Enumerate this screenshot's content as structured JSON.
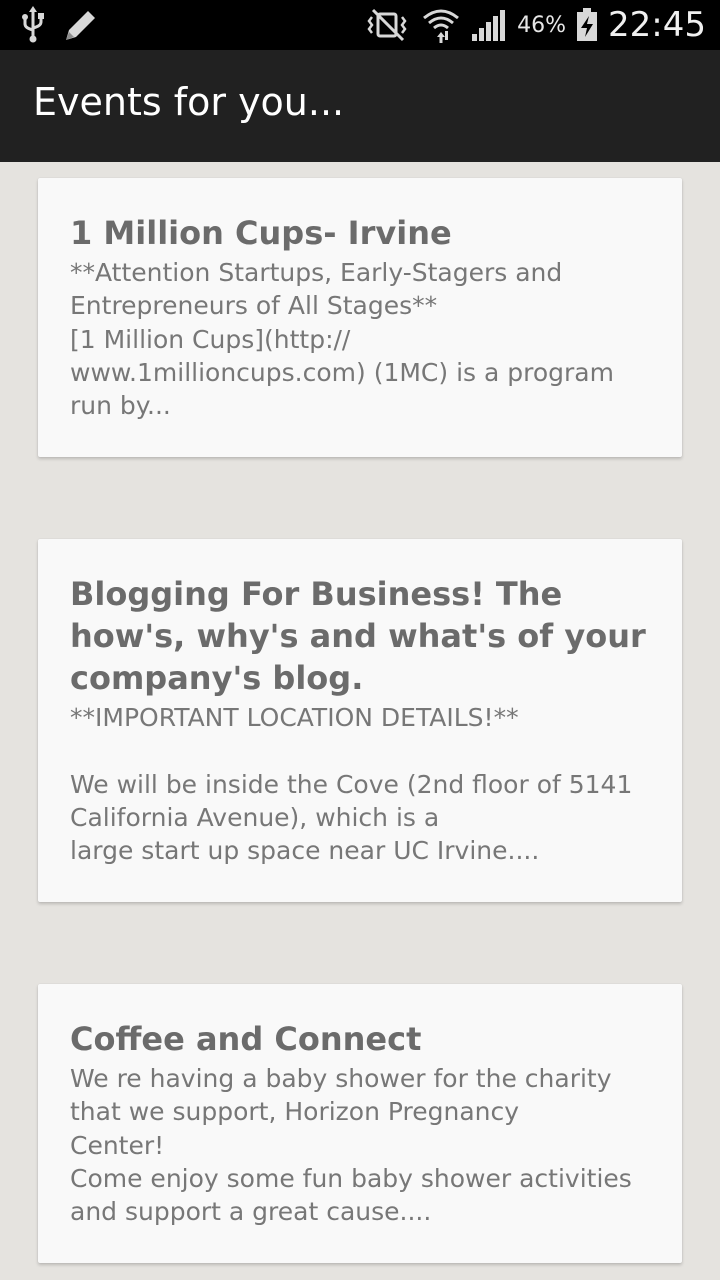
{
  "status_bar": {
    "battery_percent": "46%",
    "time": "22:45",
    "icons": [
      "usb-icon",
      "edit-icon",
      "vibrate-icon",
      "wifi-icon",
      "signal-icon",
      "battery-charging-icon"
    ]
  },
  "action_bar": {
    "title": "Events for you..."
  },
  "events": [
    {
      "title": "1 Million Cups- Irvine",
      "description": "**Attention Startups, Early-Stagers and\nEntrepreneurs of All Stages**\n[1 Million Cups](http://\nwww.1millioncups.com) (1MC) is a program\nrun by..."
    },
    {
      "title": "Blogging For Business! The how's, why's and what's of your company's blog.",
      "description": "**IMPORTANT LOCATION DETAILS!**\n\nWe will be inside the Cove (2nd floor of 5141\nCalifornia Avenue), which is a\nlarge start up space near UC Irvine...."
    },
    {
      "title": "Coffee and Connect",
      "description": "We re having a baby shower for the charity\nthat we support, Horizon Pregnancy\nCenter!\nCome enjoy some fun baby shower activities\nand support a great cause...."
    }
  ],
  "colors": {
    "status_bar_bg": "#000000",
    "action_bar_bg": "#212121",
    "page_bg": "#e5e3df",
    "card_bg": "#f9f9f9",
    "card_title": "#6b6b6b",
    "card_text": "#777777"
  }
}
